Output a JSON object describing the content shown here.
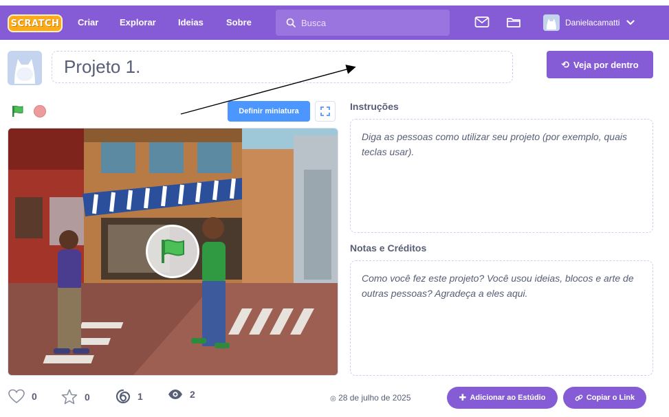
{
  "navbar": {
    "logo": "SCRATCH",
    "links": [
      "Criar",
      "Explorar",
      "Ideias",
      "Sobre"
    ],
    "search_placeholder": "Busca",
    "username": "Danielacamatti"
  },
  "project": {
    "title": "Projeto 1.",
    "see_inside_label": "Veja por dentro",
    "thumbnail_button": "Definir miniatura"
  },
  "instructions": {
    "heading": "Instruções",
    "placeholder": "Diga as pessoas como utilizar seu projeto (por exemplo, quais teclas usar)."
  },
  "notes": {
    "heading": "Notas e Créditos",
    "placeholder": "Como você fez este projeto? Você usou ideias, blocos e arte de outras pessoas? Agradeça a eles aqui."
  },
  "stats": {
    "loves": "0",
    "favorites": "0",
    "remixes": "1",
    "views": "2"
  },
  "footer": {
    "date": "28 de julho de 2025",
    "add_to_studio": "Adicionar ao Estúdio",
    "copy_link": "Copiar o Link"
  },
  "colors": {
    "brand": "#855cd6",
    "blue": "#4c97ff",
    "text": "#575e75"
  }
}
